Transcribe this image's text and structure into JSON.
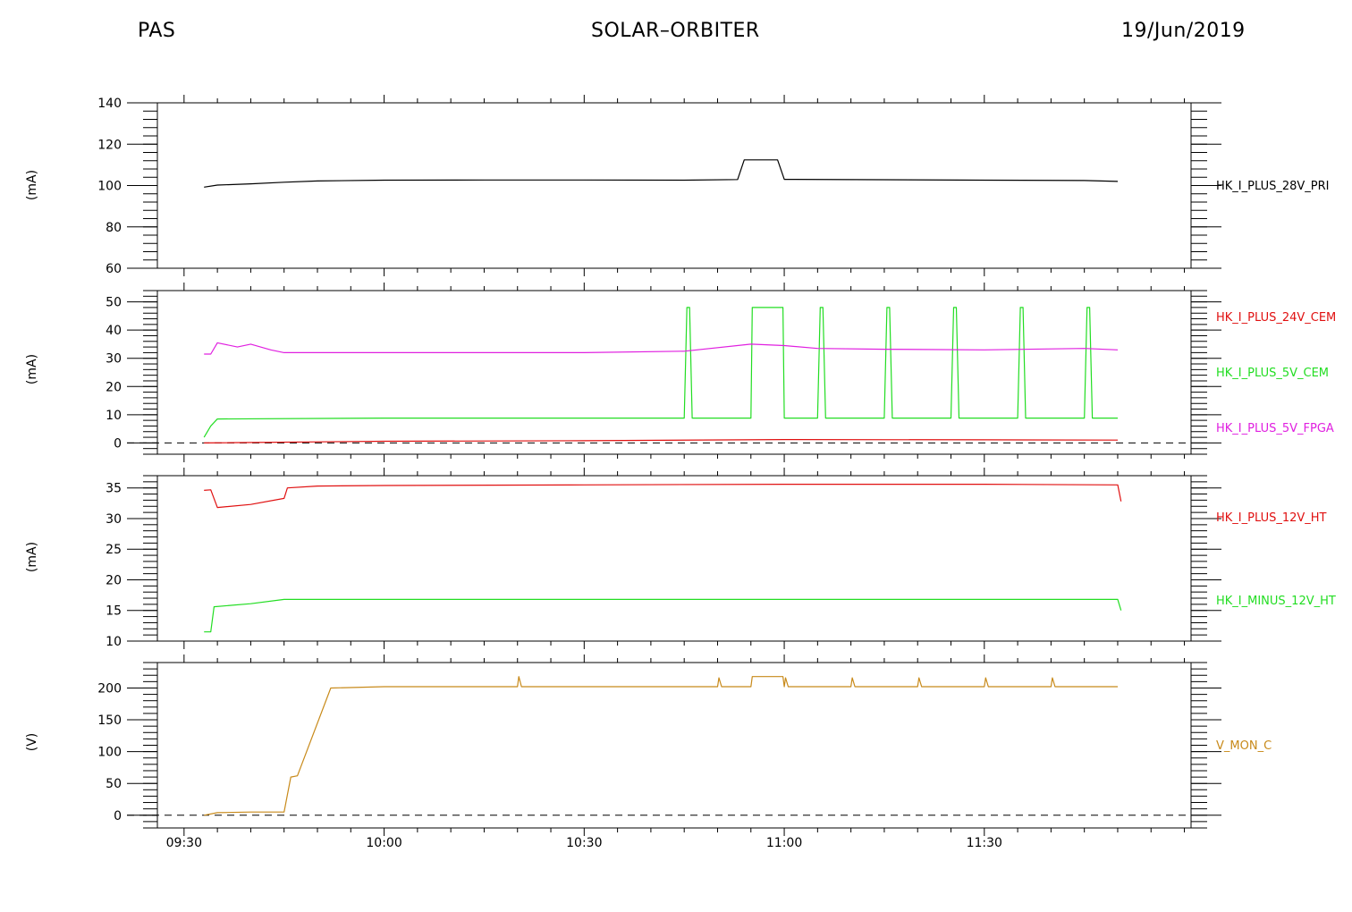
{
  "header": {
    "left": "PAS",
    "center": "SOLAR–ORBITER",
    "right": "19/Jun/2019"
  },
  "chart_data": [
    {
      "type": "line",
      "ylabel": "(mA)",
      "ylim": [
        60,
        140
      ],
      "yticks": [
        60,
        80,
        100,
        120,
        140
      ],
      "xlim": [
        "09:26",
        "12:01"
      ],
      "xticks": [
        "09:30",
        "10:00",
        "10:30",
        "11:00",
        "11:30"
      ],
      "legend_placement": "right",
      "series": [
        {
          "name": "HK_I_PLUS_28V_PRI",
          "color": "#000000",
          "points": [
            [
              "09:33",
              99.2
            ],
            [
              "09:35",
              100.2
            ],
            [
              "09:40",
              100.8
            ],
            [
              "09:45",
              101.6
            ],
            [
              "09:50",
              102.2
            ],
            [
              "10:00",
              102.6
            ],
            [
              "10:15",
              102.7
            ],
            [
              "10:30",
              102.7
            ],
            [
              "10:45",
              102.6
            ],
            [
              "10:53",
              102.9
            ],
            [
              "10:54",
              112.4
            ],
            [
              "10:59",
              112.4
            ],
            [
              "11:00",
              103.0
            ],
            [
              "11:15",
              102.8
            ],
            [
              "11:30",
              102.6
            ],
            [
              "11:45",
              102.4
            ],
            [
              "11:50",
              102.0
            ]
          ]
        }
      ]
    },
    {
      "type": "line",
      "ylabel": "(mA)",
      "ylim": [
        -4,
        54
      ],
      "yticks": [
        0,
        10,
        20,
        30,
        40,
        50
      ],
      "xlim": [
        "09:26",
        "12:01"
      ],
      "xticks": [
        "09:30",
        "10:00",
        "10:30",
        "11:00",
        "11:30"
      ],
      "reference_line": 0,
      "legend_placement": "right",
      "series": [
        {
          "name": "HK_I_PLUS_24V_CEM",
          "color": "#e01010",
          "points": [
            [
              "09:33",
              0.0
            ],
            [
              "10:00",
              0.6
            ],
            [
              "10:30",
              0.8
            ],
            [
              "11:00",
              1.2
            ],
            [
              "11:30",
              1.1
            ],
            [
              "11:50",
              1.0
            ]
          ]
        },
        {
          "name": "HK_I_PLUS_5V_CEM",
          "color": "#22dd22",
          "points": [
            [
              "09:33",
              2.0
            ],
            [
              "09:34",
              6.0
            ],
            [
              "09:35",
              8.5
            ],
            [
              "10:00",
              8.8
            ],
            [
              "10:30",
              8.8
            ],
            [
              "10:45",
              8.8
            ],
            [
              "10:45.4",
              48.0
            ],
            [
              "10:45.8",
              48.0
            ],
            [
              "10:46.2",
              8.8
            ],
            [
              "10:55",
              8.8
            ],
            [
              "10:55.2",
              48.0
            ],
            [
              "10:59.8",
              48.0
            ],
            [
              "11:00",
              8.8
            ],
            [
              "11:05",
              8.8
            ],
            [
              "11:05.4",
              48.0
            ],
            [
              "11:05.8",
              48.0
            ],
            [
              "11:06.2",
              8.8
            ],
            [
              "11:15",
              8.8
            ],
            [
              "11:15.4",
              48.0
            ],
            [
              "11:15.8",
              48.0
            ],
            [
              "11:16.2",
              8.8
            ],
            [
              "11:25",
              8.8
            ],
            [
              "11:25.4",
              48.0
            ],
            [
              "11:25.8",
              48.0
            ],
            [
              "11:26.2",
              8.8
            ],
            [
              "11:35",
              8.8
            ],
            [
              "11:35.4",
              48.0
            ],
            [
              "11:35.8",
              48.0
            ],
            [
              "11:36.2",
              8.8
            ],
            [
              "11:45",
              8.8
            ],
            [
              "11:45.4",
              48.0
            ],
            [
              "11:45.8",
              48.0
            ],
            [
              "11:46.2",
              8.8
            ],
            [
              "11:50",
              8.8
            ]
          ]
        },
        {
          "name": "HK_I_PLUS_5V_FPGA",
          "color": "#e020e0",
          "points": [
            [
              "09:33",
              31.5
            ],
            [
              "09:34",
              31.5
            ],
            [
              "09:35",
              35.5
            ],
            [
              "09:38",
              34.0
            ],
            [
              "09:40",
              35.0
            ],
            [
              "09:43",
              33.0
            ],
            [
              "09:45",
              32.0
            ],
            [
              "10:00",
              32.0
            ],
            [
              "10:30",
              32.0
            ],
            [
              "10:45",
              32.5
            ],
            [
              "10:55",
              35.0
            ],
            [
              "11:00",
              34.5
            ],
            [
              "11:05",
              33.5
            ],
            [
              "11:15",
              33.2
            ],
            [
              "11:30",
              33.0
            ],
            [
              "11:45",
              33.5
            ],
            [
              "11:50",
              33.0
            ]
          ]
        }
      ]
    },
    {
      "type": "line",
      "ylabel": "(mA)",
      "ylim": [
        10,
        37
      ],
      "yticks": [
        10,
        15,
        20,
        25,
        30,
        35
      ],
      "xlim": [
        "09:26",
        "12:01"
      ],
      "xticks": [
        "09:30",
        "10:00",
        "10:30",
        "11:00",
        "11:30"
      ],
      "legend_placement": "right",
      "series": [
        {
          "name": "HK_I_PLUS_12V_HT",
          "color": "#e01010",
          "points": [
            [
              "09:33",
              34.6
            ],
            [
              "09:34",
              34.7
            ],
            [
              "09:35",
              31.8
            ],
            [
              "09:40",
              32.3
            ],
            [
              "09:45",
              33.3
            ],
            [
              "09:45.5",
              35.0
            ],
            [
              "09:50",
              35.3
            ],
            [
              "10:00",
              35.4
            ],
            [
              "10:30",
              35.5
            ],
            [
              "11:00",
              35.6
            ],
            [
              "11:30",
              35.6
            ],
            [
              "11:50",
              35.5
            ],
            [
              "11:50.5",
              32.8
            ]
          ]
        },
        {
          "name": "HK_I_MINUS_12V_HT",
          "color": "#22dd22",
          "points": [
            [
              "09:33",
              11.5
            ],
            [
              "09:34",
              11.5
            ],
            [
              "09:34.5",
              15.6
            ],
            [
              "09:40",
              16.1
            ],
            [
              "09:45",
              16.8
            ],
            [
              "10:00",
              16.8
            ],
            [
              "10:30",
              16.8
            ],
            [
              "11:00",
              16.8
            ],
            [
              "11:30",
              16.8
            ],
            [
              "11:50",
              16.8
            ],
            [
              "11:50.5",
              15.0
            ]
          ]
        }
      ]
    },
    {
      "type": "line",
      "ylabel": "(V)",
      "ylim": [
        -20,
        240
      ],
      "yticks": [
        0,
        50,
        100,
        150,
        200
      ],
      "xlim": [
        "09:26",
        "12:01"
      ],
      "xticks": [
        "09:30",
        "10:00",
        "10:30",
        "11:00",
        "11:30"
      ],
      "reference_line": 0,
      "legend_placement": "right",
      "series": [
        {
          "name": "V_MON_C",
          "color": "#c88a1a",
          "points": [
            [
              "09:33",
              0
            ],
            [
              "09:35",
              4
            ],
            [
              "09:40",
              5
            ],
            [
              "09:45",
              5
            ],
            [
              "09:46",
              60
            ],
            [
              "09:47",
              62
            ],
            [
              "09:52",
              200
            ],
            [
              "10:00",
              202
            ],
            [
              "10:20",
              202
            ],
            [
              "10:20.2",
              218
            ],
            [
              "10:20.6",
              202
            ],
            [
              "10:50",
              202
            ],
            [
              "10:50.2",
              216
            ],
            [
              "10:50.6",
              202
            ],
            [
              "10:55",
              202
            ],
            [
              "10:55.2",
              218
            ],
            [
              "10:59.8",
              218
            ],
            [
              "11:00",
              202
            ],
            [
              "11:00.2",
              216
            ],
            [
              "11:00.6",
              202
            ],
            [
              "11:10",
              202
            ],
            [
              "11:10.2",
              216
            ],
            [
              "11:10.6",
              202
            ],
            [
              "11:20",
              202
            ],
            [
              "11:20.2",
              216
            ],
            [
              "11:20.6",
              202
            ],
            [
              "11:30",
              202
            ],
            [
              "11:30.2",
              216
            ],
            [
              "11:30.6",
              202
            ],
            [
              "11:40",
              202
            ],
            [
              "11:40.2",
              216
            ],
            [
              "11:40.6",
              202
            ],
            [
              "11:50",
              202
            ]
          ]
        }
      ]
    }
  ]
}
